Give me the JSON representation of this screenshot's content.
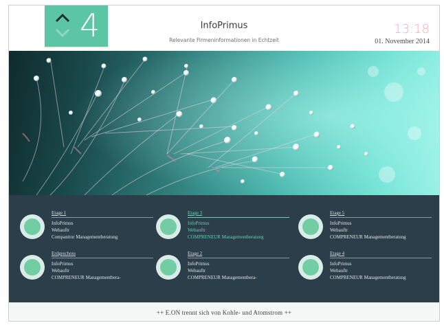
{
  "header": {
    "floor_number": "4",
    "app_title": "InfoPrimus",
    "app_subtitle": "Relevante Firmeninformationen in Echtzeit",
    "clock": "13:18",
    "date": "01. November 2014",
    "accent_color": "#5cc6a4",
    "clock_color": "#f2a9bd"
  },
  "entries": [
    {
      "floor": "Etage 1",
      "lines": [
        "InfoPrimus",
        "Webauftr",
        "Companitor Managementberatung"
      ],
      "active": false
    },
    {
      "floor": "Etage 3",
      "lines": [
        "InfoPrimus",
        "Webauftr",
        "COMPRENEUR Managementberatung"
      ],
      "active": true
    },
    {
      "floor": "Etage 5",
      "lines": [
        "InfoPrimus",
        "Webauftr",
        "COMPRENEUR Managementberatung"
      ],
      "active": false
    },
    {
      "floor": "Erdgeschoss",
      "lines": [
        "InfoPrimus",
        "Webauftr",
        "COMPRENEUR Managementbera-"
      ],
      "active": false
    },
    {
      "floor": "Etage 2",
      "lines": [
        "InfoPrimus",
        "Webauftr",
        "COMPRENEUR Managementbera-"
      ],
      "active": false
    },
    {
      "floor": "Etage 4",
      "lines": [
        "InfoPrimus",
        "Webauftr",
        "COMPRENEUR Managementberatung"
      ],
      "active": false
    }
  ],
  "ticker": {
    "text": "++ E.ON trennt sich von Kohle- und Atomstrom ++"
  },
  "icons": [
    "chevron-up-icon",
    "chevron-down-icon",
    "floor-ring-icon"
  ]
}
